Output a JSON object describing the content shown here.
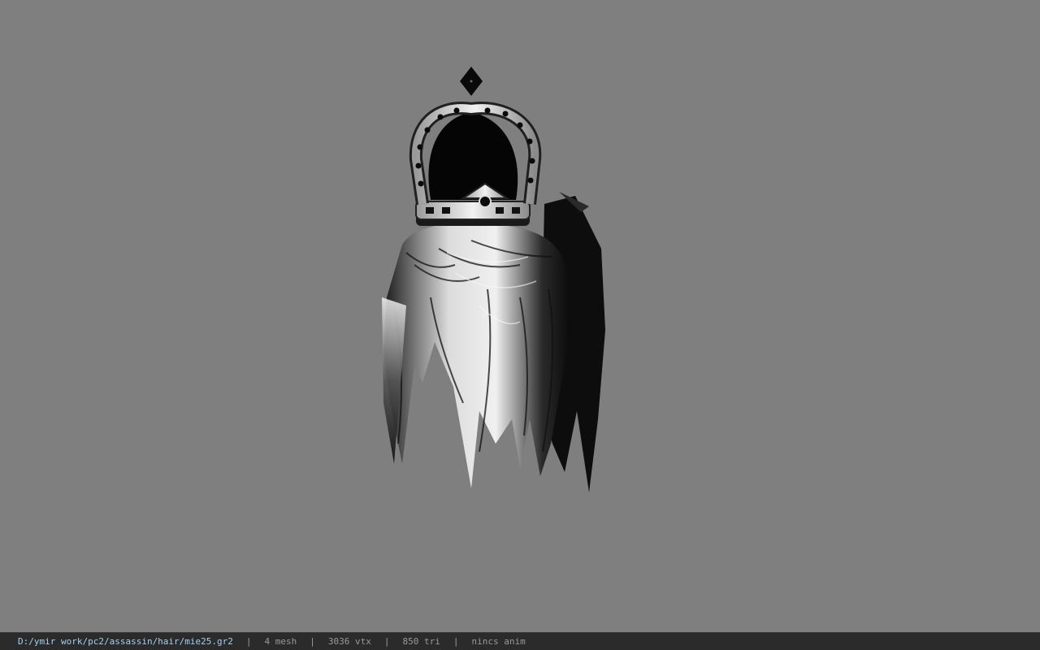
{
  "viewport": {
    "background": "#7f7f7f",
    "model_icon": "crown-hair-model"
  },
  "statusbar": {
    "file_path": "D:/ymir work/pc2/assassin/hair/mie25.gr2",
    "separator": "|",
    "mesh_count": "4 mesh",
    "vertex_count": "3036 vtx",
    "triangle_count": "850 tri",
    "anim": "nincs anim",
    "path_color": "#9fd3f0",
    "text_color": "#9a9a9a"
  }
}
